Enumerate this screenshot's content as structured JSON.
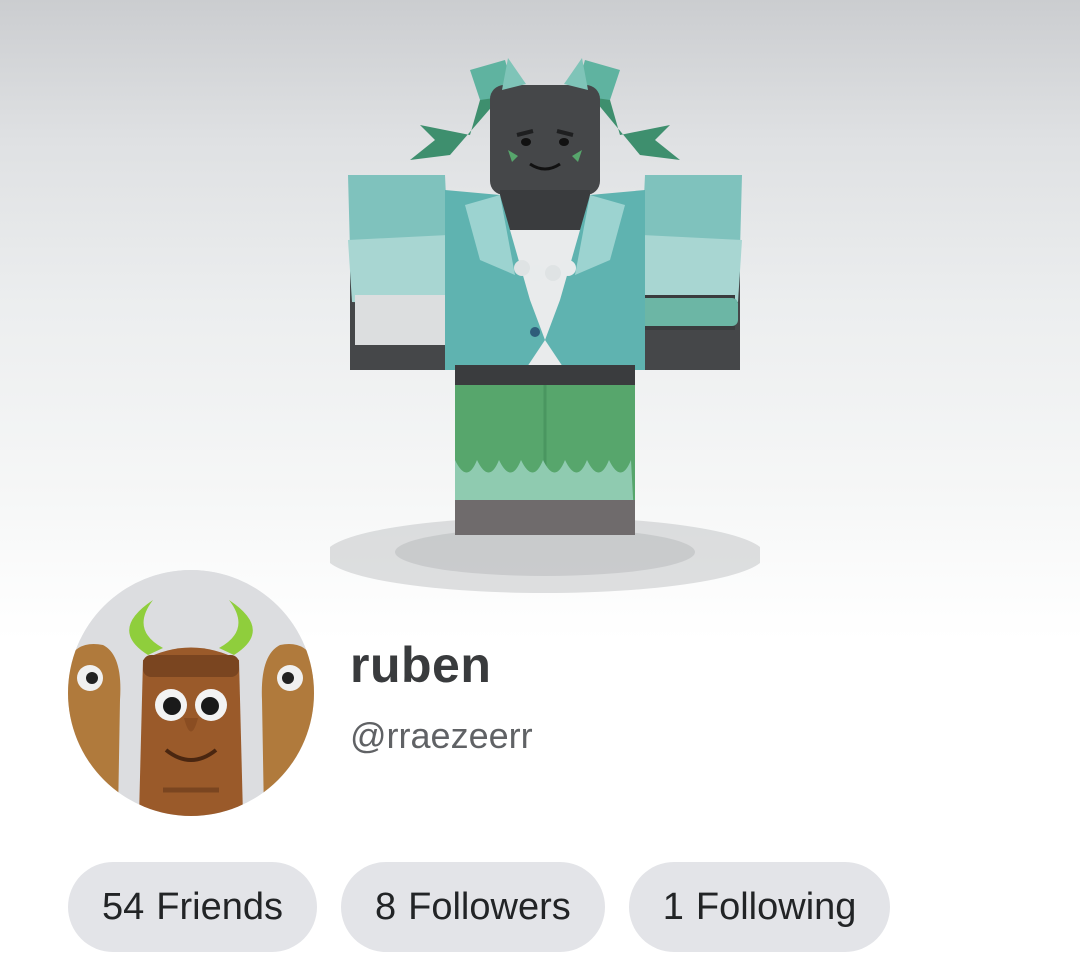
{
  "profile": {
    "display_name": "ruben",
    "username": "@rraezeerr"
  },
  "avatar": {
    "body_icon": "avatar-3d-icon",
    "headshot_icon": "tiki-headshot-icon",
    "colors": {
      "teal": "#5fb3b0",
      "light_teal": "#9cd3d0",
      "green": "#57a66c",
      "dark_skin": "#454749",
      "stage_top": "#cbcdd0"
    }
  },
  "stats": [
    {
      "count": "54",
      "label": "Friends"
    },
    {
      "count": "8",
      "label": "Followers"
    },
    {
      "count": "1",
      "label": "Following"
    }
  ]
}
